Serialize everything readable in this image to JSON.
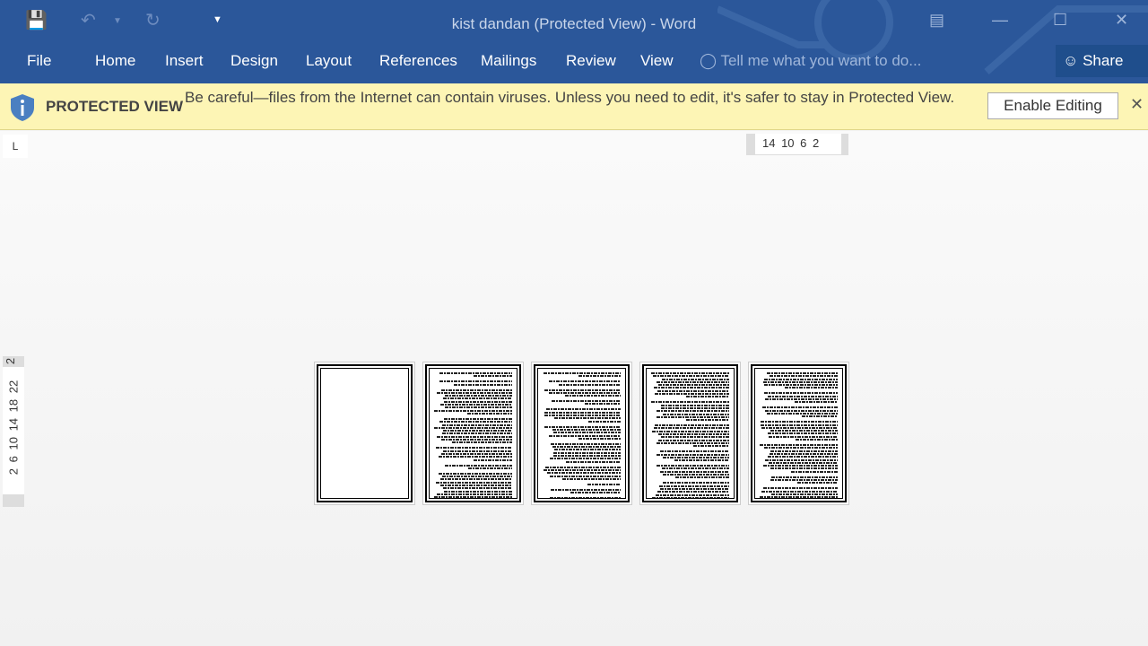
{
  "window": {
    "title": "kist dandan (Protected View) - Word"
  },
  "qat": {
    "icons": [
      "save-icon",
      "undo-icon",
      "redo-icon",
      "customize-icon"
    ]
  },
  "tabs": [
    "File",
    "Home",
    "Insert",
    "Design",
    "Layout",
    "References",
    "Mailings",
    "Review",
    "View"
  ],
  "tell_me": "Tell me what you want to do...",
  "share": "Share",
  "protected": {
    "title": "PROTECTED VIEW",
    "message": "Be careful—files from the Internet can contain viruses. Unless you need to edit, it's safer to stay in Protected View.",
    "button": "Enable Editing"
  },
  "ruler": {
    "horizontal": "14 10 6 2",
    "vertical_top": "2",
    "vertical": "2 6 10 14 18 22",
    "tab_selector": "L"
  },
  "colors": {
    "ribbon": "#2b579a",
    "protected_bar": "#fdf5b5"
  },
  "pages": [
    {
      "page": 1,
      "blank": true
    },
    {
      "page": 2
    },
    {
      "page": 3
    },
    {
      "page": 4
    },
    {
      "page": 5
    }
  ]
}
